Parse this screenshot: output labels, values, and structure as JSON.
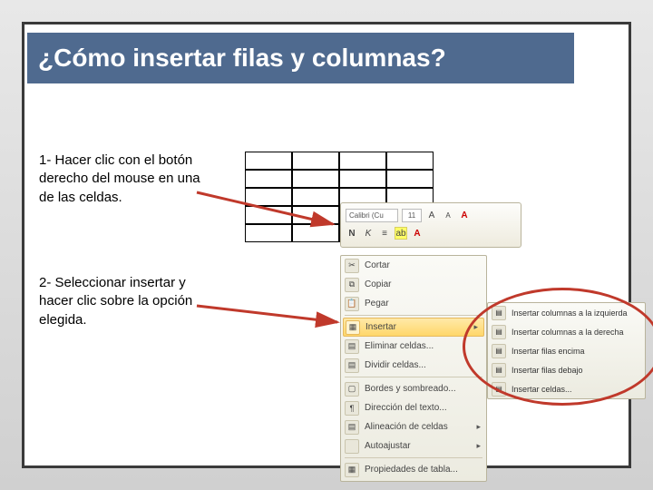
{
  "title": "¿Cómo insertar filas y columnas?",
  "steps": {
    "one": "1- Hacer clic con el botón derecho del mouse en una de las celdas.",
    "two": "2- Seleccionar insertar y hacer clic sobre la opción elegida."
  },
  "mini_toolbar": {
    "font": "Calibri (Cu",
    "size": "11",
    "grow": "A",
    "shrink": "A",
    "bold": "N",
    "italic": "K",
    "align": "≡",
    "highlight": "ab",
    "colorA": "A"
  },
  "context_menu": {
    "cut": "Cortar",
    "copy": "Copiar",
    "paste": "Pegar",
    "insert": "Insertar",
    "delete_cells": "Eliminar celdas...",
    "split_cells": "Dividir celdas...",
    "borders": "Bordes y sombreado...",
    "text_direction": "Dirección del texto...",
    "cell_align": "Alineación de celdas",
    "autofit": "Autoajustar",
    "table_props": "Propiedades de tabla..."
  },
  "submenu": {
    "cols_left": "Insertar columnas a la izquierda",
    "cols_right": "Insertar columnas a la derecha",
    "rows_above": "Insertar filas encima",
    "rows_below": "Insertar filas debajo",
    "cells": "Insertar celdas..."
  },
  "icons": {
    "scissors": "✂",
    "copy": "⧉",
    "paste": "📋",
    "table": "▦",
    "grid": "▤",
    "border": "▢",
    "textdir": "¶",
    "arrow_r": "▸"
  }
}
